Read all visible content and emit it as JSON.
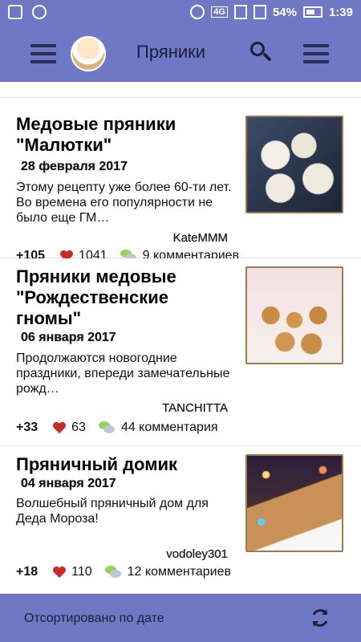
{
  "status_bar": {
    "network": "4G",
    "battery": "54%",
    "time": "1:39"
  },
  "app_bar": {
    "title": "Пряники",
    "icons": [
      "menu-icon",
      "logo-chef",
      "search-icon",
      "menu-icon"
    ]
  },
  "colors": {
    "bar": "#6f78c4",
    "heart": "#cc2a2a",
    "bubble_green": "#8fd65b"
  },
  "recipes": [
    {
      "title": "Медовые пряники \"Малютки\"",
      "date": "28 февраля 2017",
      "desc": "Этому рецепту уже более 60-ти лет. Во времена его популярности не было еще ГМ…",
      "author": "KateMMM",
      "votes": "+105",
      "likes": "1041",
      "comments": "9 комментариев"
    },
    {
      "title": "Пряники медовые \"Рождественские гномы\"",
      "date": "06 января 2017",
      "desc": "Продолжаются новогодние праздники, впереди замечательные рожд…",
      "author": "TANCHITTA",
      "votes": "+33",
      "likes": "63",
      "comments": "44 комментария"
    },
    {
      "title": "Пряничный домик",
      "date": "04 января 2017",
      "desc": "Волшебный пряничный дом для Деда Мороза!",
      "author": "vodoley301",
      "votes": "+18",
      "likes": "110",
      "comments": "12 комментариев"
    }
  ],
  "bottom_bar": {
    "sort_label": "Отсортировано по дате",
    "icon": "refresh-icon"
  }
}
